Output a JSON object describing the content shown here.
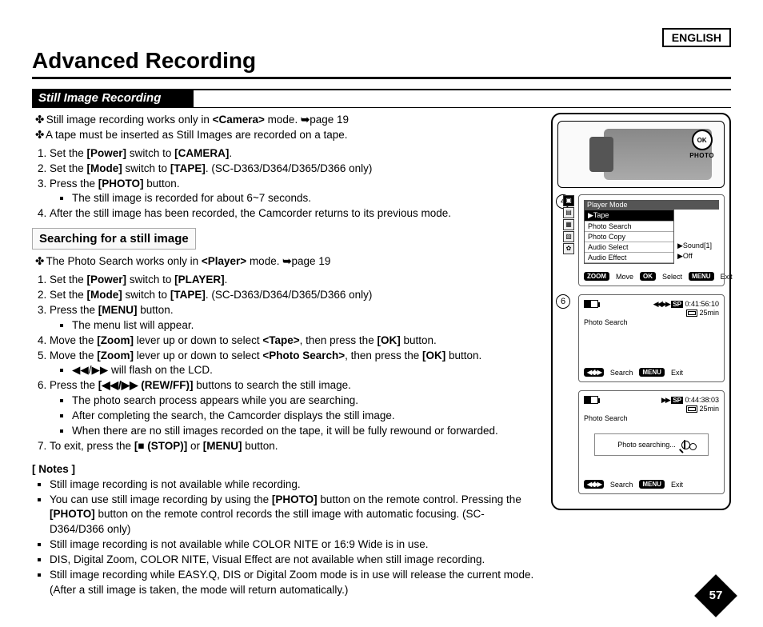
{
  "lang": "ENGLISH",
  "title": "Advanced Recording",
  "section": "Still Image Recording",
  "lead1_a": "Still image recording works only in ",
  "lead1_b": "<Camera>",
  "lead1_c": " mode. ",
  "lead1_d": "page 19",
  "lead2": "A tape must be inserted as Still Images are recorded on a tape.",
  "step1_a": "Set the ",
  "step1_b": "[Power]",
  "step1_c": " switch to ",
  "step1_d": "[CAMERA]",
  "step1_e": ".",
  "step2_a": "Set the ",
  "step2_b": "[Mode]",
  "step2_c": " switch to ",
  "step2_d": "[TAPE]",
  "step2_e": ". (SC-D363/D364/D365/D366 only)",
  "step3_a": "Press the ",
  "step3_b": "[PHOTO]",
  "step3_c": " button.",
  "step3_sub": "The still image is recorded for about 6~7 seconds.",
  "step4": "After the still image has been recorded, the Camcorder returns to its previous mode.",
  "subhead": "Searching for a still image",
  "search_lead_a": "The Photo Search works only in ",
  "search_lead_b": "<Player>",
  "search_lead_c": " mode. ",
  "search_lead_d": "page 19",
  "s1_a": "Set the ",
  "s1_b": "[Power]",
  "s1_c": " switch to ",
  "s1_d": "[PLAYER]",
  "s1_e": ".",
  "s2_a": "Set the ",
  "s2_b": "[Mode]",
  "s2_c": " switch to ",
  "s2_d": "[TAPE]",
  "s2_e": ". (SC-D363/D364/D365/D366 only)",
  "s3_a": "Press the ",
  "s3_b": "[MENU]",
  "s3_c": " button.",
  "s3_sub": "The menu list will appear.",
  "s4_a": "Move the ",
  "s4_b": "[Zoom]",
  "s4_c": " lever up or down to select ",
  "s4_d": "<Tape>",
  "s4_e": ", then press the ",
  "s4_f": "[OK]",
  "s4_g": " button.",
  "s5_a": "Move the ",
  "s5_b": "[Zoom]",
  "s5_c": " lever up or down to select ",
  "s5_d": "<Photo Search>",
  "s5_e": ", then press the ",
  "s5_f": "[OK]",
  "s5_g": " button.",
  "s5_sub": "◀◀/▶▶ will flash on the LCD.",
  "s6_a": "Press the ",
  "s6_b": "[◀◀/▶▶ (REW/FF)]",
  "s6_c": " buttons to search the still image.",
  "s6_sub1": "The photo search process appears while you are searching.",
  "s6_sub2": "After completing the search, the Camcorder displays the still image.",
  "s6_sub3": "When there are no still images recorded on the tape, it will be fully rewound or forwarded.",
  "s7_a": "To exit, press the ",
  "s7_b": "[■ (STOP)]",
  "s7_c": " or ",
  "s7_d": "[MENU]",
  "s7_e": " button.",
  "notes_head": "[ Notes ]",
  "note1": "Still image recording is not available while recording.",
  "note2_a": "You can use still image recording by using the ",
  "note2_b": "[PHOTO]",
  "note2_c": " button on the remote control. Pressing the ",
  "note2_d": "[PHOTO]",
  "note2_e": " button on the remote control records the still image with automatic focusing. (SC-D364/D366 only)",
  "note3": "Still image recording is not available while COLOR NITE or 16:9 Wide is in use.",
  "note4": "DIS, Digital Zoom, COLOR NITE, Visual Effect are not available when still image recording.",
  "note5": "Still image recording while EASY.Q, DIS or Digital Zoom mode is in use will release the current mode. (After a still image is taken, the mode will return automatically.)",
  "illus": {
    "ok": "OK",
    "photo": "PHOTO"
  },
  "step_circ_4": "4",
  "step_circ_6": "6",
  "menu": {
    "title": "Player Mode",
    "tape": "Tape",
    "items": [
      "Photo Search",
      "Photo Copy",
      "Audio Select",
      "Audio Effect"
    ],
    "side": [
      "Sound[1]",
      "Off"
    ],
    "bottom_zoom": "ZOOM",
    "bottom_move": "Move",
    "bottom_ok": "OK",
    "bottom_select": "Select",
    "bottom_menu": "MENU",
    "bottom_exit": "Exit"
  },
  "osd1": {
    "label": "Photo Search",
    "sp": "SP",
    "time": "0:41:56:10",
    "remain": "25min",
    "rewff": "◀◀/▶▶",
    "search_pill": "◀◀/▶▶",
    "search": "Search",
    "menu": "MENU",
    "exit": "Exit"
  },
  "osd2": {
    "label": "Photo Search",
    "sp": "SP",
    "time": "0:44:38:03",
    "remain": "25min",
    "ff": "▶▶",
    "searching": "Photo searching...",
    "search_pill": "◀◀/▶▶",
    "search": "Search",
    "menu": "MENU",
    "exit": "Exit"
  },
  "page": "57"
}
